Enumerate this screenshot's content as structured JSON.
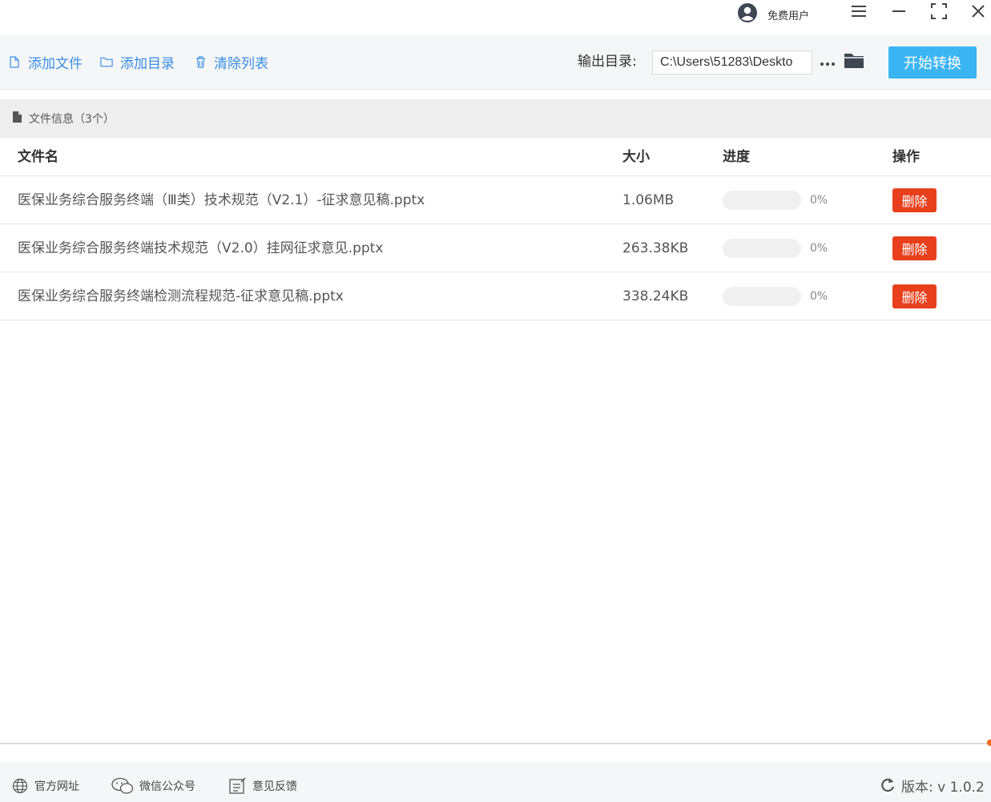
{
  "titlebar": {
    "user_label": "免费用户",
    "icons": [
      "user-avatar-icon",
      "menu-icon",
      "minimize-icon",
      "maximize-icon",
      "close-icon"
    ]
  },
  "toolbar": {
    "add_file_label": "添加文件",
    "add_dir_label": "添加目录",
    "clear_list_label": "清除列表",
    "output_dir_label": "输出目录:",
    "output_dir_value": "C:\\Users\\51283\\Deskto",
    "start_label": "开始转换",
    "accent_color": "#3a8ee6",
    "start_color": "#3bb4f2"
  },
  "section": {
    "title": "文件信息（3个）"
  },
  "table": {
    "columns": {
      "name": "文件名",
      "size": "大小",
      "progress": "进度",
      "action": "操作"
    },
    "rows": [
      {
        "name": "医保业务综合服务终端（Ⅲ类）技术规范（V2.1）-征求意见稿.pptx",
        "size": "1.06MB",
        "progress": 0,
        "progress_text": "0%",
        "action": "删除"
      },
      {
        "name": "医保业务综合服务终端技术规范（V2.0）挂网征求意见.pptx",
        "size": "263.38KB",
        "progress": 0,
        "progress_text": "0%",
        "action": "删除"
      },
      {
        "name": "医保业务综合服务终端检测流程规范-征求意见稿.pptx",
        "size": "338.24KB",
        "progress": 0,
        "progress_text": "0%",
        "action": "删除"
      }
    ],
    "delete_color": "#e8401c"
  },
  "footer": {
    "website_label": "官方网址",
    "wechat_label": "微信公众号",
    "feedback_label": "意见反馈",
    "version_label": "版本: v 1.0.2"
  }
}
